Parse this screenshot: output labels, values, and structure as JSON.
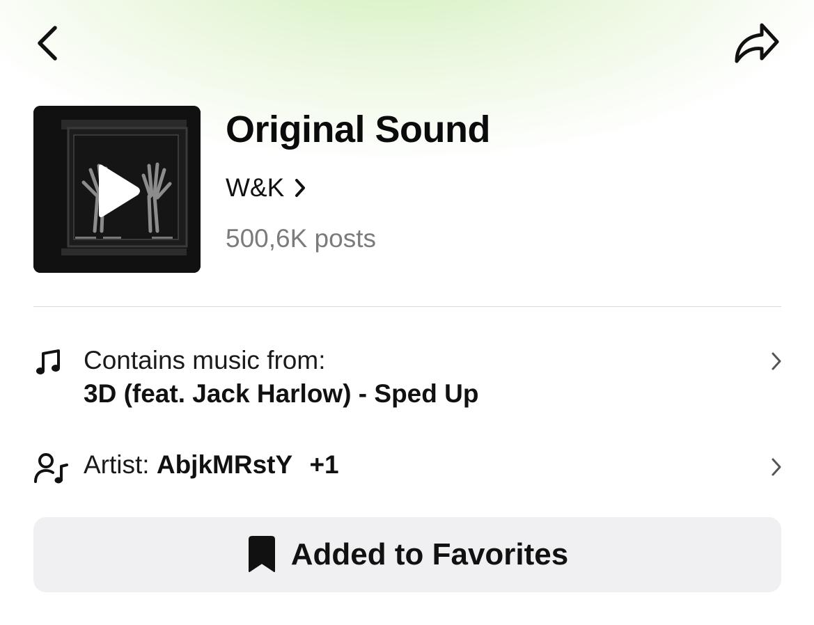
{
  "header": {
    "back_icon": "chevron-left-icon",
    "share_icon": "share-arrow-icon"
  },
  "sound": {
    "cover_icon": "play-icon",
    "title": "Original Sound",
    "author": "W&K",
    "posts": "500,6K posts"
  },
  "music_row": {
    "icon": "music-note-icon",
    "label": "Contains music from:",
    "track": "3D (feat. Jack Harlow) - Sped Up"
  },
  "artist_row": {
    "icon": "artist-icon",
    "label": "Artist:",
    "name": "AbjkMRstY",
    "more": "+1"
  },
  "favorite_button": {
    "icon": "bookmark-icon",
    "label": "Added to Favorites"
  },
  "colors": {
    "header_tint": "#d6f0c0",
    "muted_text": "#7b7b7b",
    "button_bg": "#f0f0f2"
  }
}
